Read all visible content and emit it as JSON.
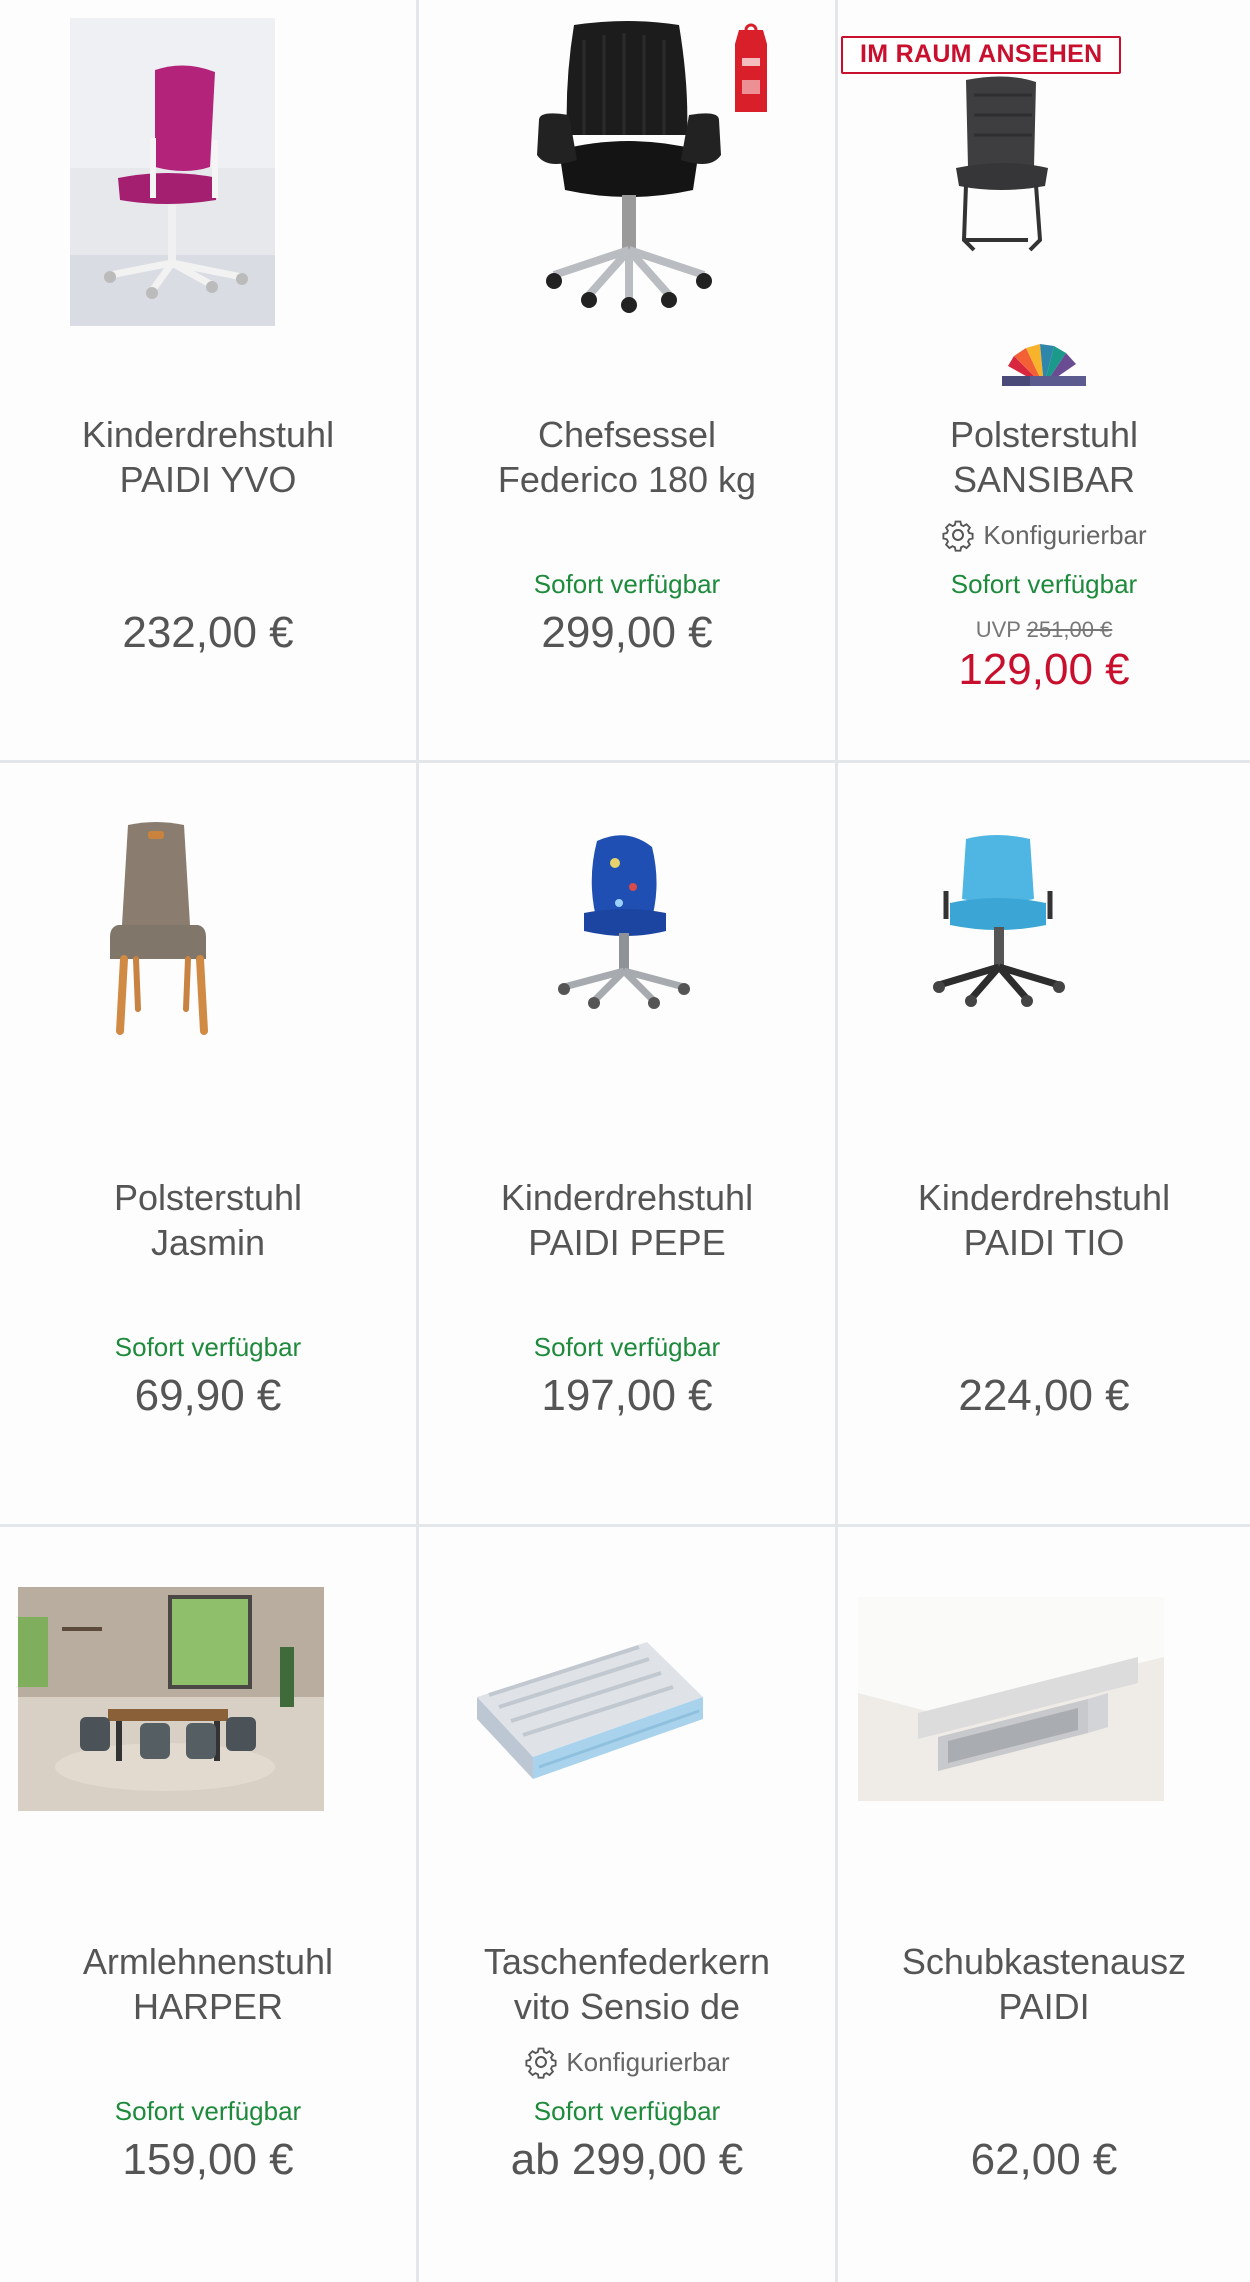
{
  "products": [
    {
      "title_1": "Kinderdrehstuhl",
      "title_2": "PAIDI YVO",
      "price": "232,00 €",
      "availability": "",
      "configurable": "",
      "badge": "",
      "image": "pink-swivel-chair"
    },
    {
      "title_1": "Chefsessel",
      "title_2": "Federico 180 kg",
      "price": "299,00 €",
      "availability": "Sofort verfügbar",
      "configurable": "",
      "badge": "",
      "image": "black-executive-chair"
    },
    {
      "title_1": "Polsterstuhl",
      "title_2": "SANSIBAR",
      "price": "129,00 €",
      "availability": "Sofort verfügbar",
      "configurable": "Konfigurierbar",
      "badge": "IM RAUM ANSEHEN",
      "uvp_label": "UVP",
      "uvp_price": "251,00 €",
      "image": "grey-cantilever-chair",
      "brand_logo": "color-fan-logo"
    },
    {
      "title_1": "Polsterstuhl",
      "title_2": "Jasmin",
      "price": "69,90 €",
      "availability": "Sofort verfügbar",
      "configurable": "",
      "badge": "",
      "image": "taupe-dining-chair"
    },
    {
      "title_1": "Kinderdrehstuhl",
      "title_2": "PAIDI PEPE",
      "price": "197,00 €",
      "availability": "Sofort verfügbar",
      "configurable": "",
      "badge": "",
      "image": "blue-kids-swivel-chair"
    },
    {
      "title_1": "Kinderdrehstuhl",
      "title_2": "PAIDI TIO",
      "price": "224,00 €",
      "availability": "",
      "configurable": "",
      "badge": "",
      "image": "light-blue-swivel-chair"
    },
    {
      "title_1": "Armlehnenstuhl",
      "title_2": "HARPER",
      "price": "159,00 €",
      "availability": "Sofort verfügbar",
      "configurable": "",
      "badge": "",
      "image": "dining-room-scene"
    },
    {
      "title_1": "Taschenfederkern",
      "title_2": "vito Sensio de",
      "price": "ab 299,00 €",
      "availability": "Sofort verfügbar",
      "configurable": "Konfigurierbar",
      "badge": "",
      "image": "mattress"
    },
    {
      "title_1": "Schubkastenausz",
      "title_2": "PAIDI",
      "price": "62,00 €",
      "availability": "",
      "configurable": "",
      "badge": "",
      "image": "desk-drawer"
    }
  ],
  "colors": {
    "availability": "#1e8a3c",
    "sale": "#c8102e",
    "badge": "#c8102e",
    "divider": "#e4e7ea"
  }
}
